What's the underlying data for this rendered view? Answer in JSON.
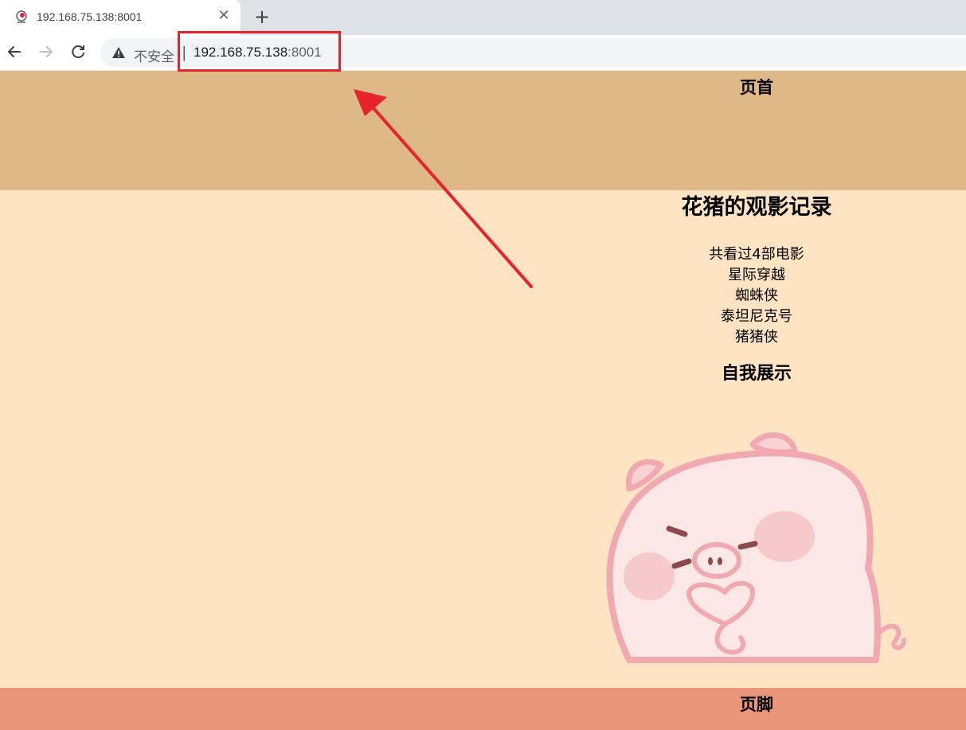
{
  "browser": {
    "tab": {
      "title": "192.168.75.138:8001",
      "close_icon": "close-icon",
      "favicon": "pig-favicon-icon"
    },
    "new_tab_label": "+",
    "address_bar": {
      "security_label": "不安全",
      "separator": "|",
      "host": "192.168.75.138",
      "port": ":8001",
      "warning_icon": "warning-icon"
    },
    "annotation_color": "#e8232a"
  },
  "page": {
    "header": {
      "title": "页首",
      "background": "#deb887"
    },
    "main": {
      "title": "花猪的观影记录",
      "summary": "共看过4部电影",
      "movies": [
        "星际穿越",
        "蜘蛛侠",
        "泰坦尼克号",
        "猪猪侠"
      ],
      "section_title": "自我展示",
      "image": "pig-illustration",
      "background": "#ffe4c4"
    },
    "footer": {
      "title": "页脚",
      "background": "#e9967a"
    }
  }
}
